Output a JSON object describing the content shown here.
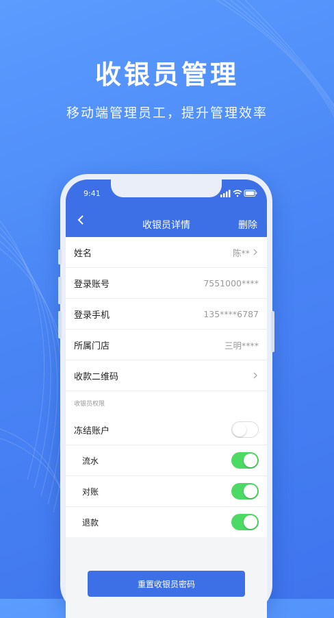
{
  "hero": {
    "title": "收银员管理",
    "subtitle": "移动端管理员工，提升管理效率"
  },
  "status_bar": {
    "time": "9:41"
  },
  "nav": {
    "title": "收银员详情",
    "action": "删除"
  },
  "info_rows": [
    {
      "label": "姓名",
      "value": "陈**"
    },
    {
      "label": "登录账号",
      "value": "7551000****"
    },
    {
      "label": "登录手机",
      "value": "135****6787"
    },
    {
      "label": "所属门店",
      "value": "三明****"
    },
    {
      "label": "收款二维码",
      "value": ""
    }
  ],
  "permissions": {
    "header": "收银员权限",
    "freeze": {
      "label": "冻结账户",
      "on": false
    },
    "items": [
      {
        "label": "流水",
        "on": true
      },
      {
        "label": "对账",
        "on": true
      },
      {
        "label": "退款",
        "on": true
      }
    ]
  },
  "reset_button": "重置收银员密码",
  "colors": {
    "accent": "#3d6fe6",
    "toggle_on": "#4cd964"
  }
}
